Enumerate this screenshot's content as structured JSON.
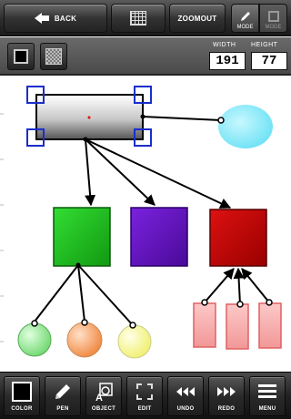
{
  "toolbar": {
    "back_label": "BACK",
    "grid_icon": "grid-icon",
    "zoomout_label": "ZOOMOUT",
    "mode_draw_label": "MODE",
    "mode_select_label": "MODE"
  },
  "properties": {
    "fill_solid_icon": "fill-solid-icon",
    "fill_gradient_icon": "fill-gradient-icon",
    "width_label": "WIDTH",
    "height_label": "HEIGHT",
    "width_value": "191",
    "height_value": "77"
  },
  "canvas": {
    "shapes": [
      {
        "name": "selected-gradient-rectangle",
        "kind": "rect",
        "fill": "gradient-gray",
        "selected": true
      },
      {
        "name": "cyan-ellipse",
        "kind": "ellipse",
        "fill": "#7fe8f8"
      },
      {
        "name": "green-square",
        "kind": "rect",
        "fill": "#22cc22"
      },
      {
        "name": "purple-square",
        "kind": "rect",
        "fill": "#6a14c8"
      },
      {
        "name": "red-square",
        "kind": "rect",
        "fill": "#cc0000"
      },
      {
        "name": "green-circle",
        "kind": "circle",
        "fill": "#90e890"
      },
      {
        "name": "orange-circle",
        "kind": "circle",
        "fill": "#f5a060"
      },
      {
        "name": "yellow-circle",
        "kind": "circle",
        "fill": "#f8f8a0"
      },
      {
        "name": "pink-rect-1",
        "kind": "rect",
        "fill": "#f8a8a8"
      },
      {
        "name": "pink-rect-2",
        "kind": "rect",
        "fill": "#f8a8a8"
      },
      {
        "name": "pink-rect-3",
        "kind": "rect",
        "fill": "#f8a8a8"
      }
    ]
  },
  "bottom": {
    "color_label": "COLOR",
    "pen_label": "PEN",
    "object_label": "OBJECT",
    "edit_label": "EDIT",
    "undo_label": "UNDO",
    "redo_label": "REDO",
    "menu_label": "MENU"
  },
  "colors": {
    "toolbar_dark": "#222222",
    "selection_handle": "#1a2ecc"
  }
}
